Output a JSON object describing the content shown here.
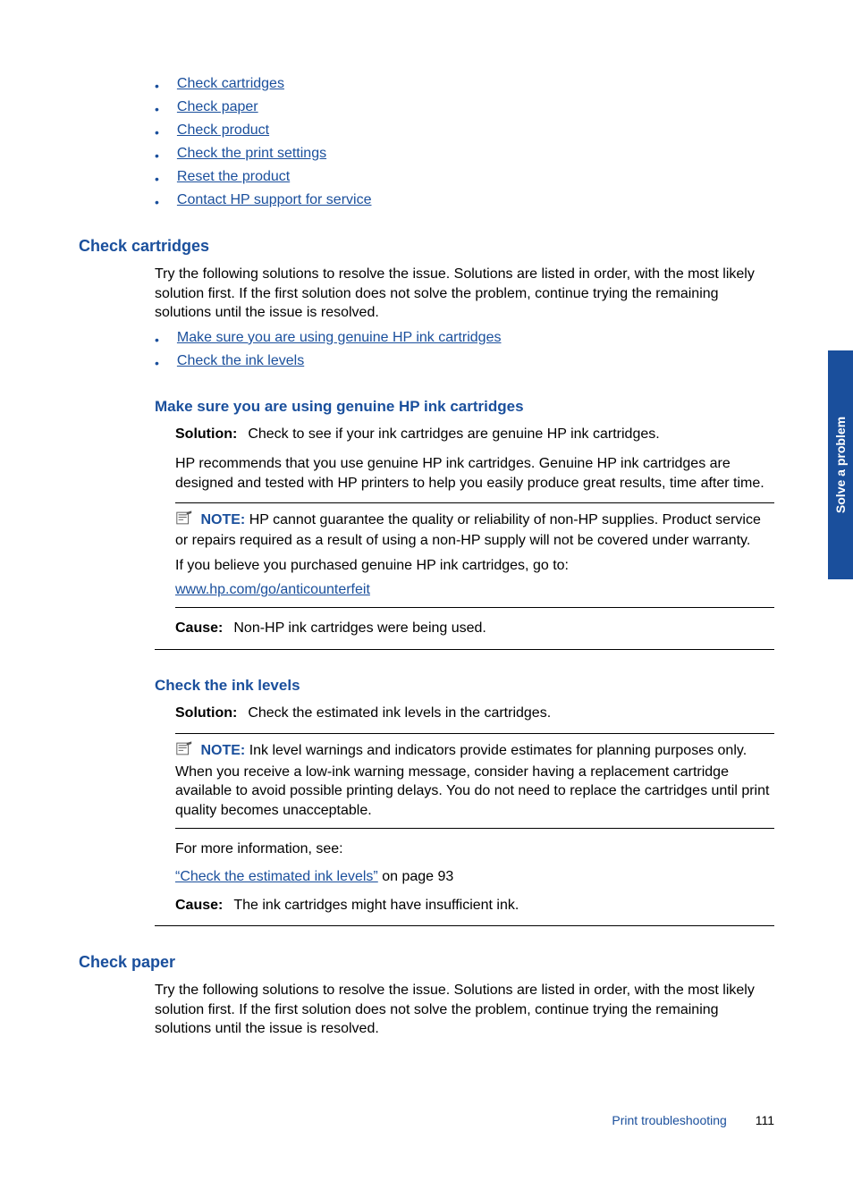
{
  "toc": {
    "items": [
      "Check cartridges",
      "Check paper",
      "Check product",
      "Check the print settings",
      "Reset the product",
      "Contact HP support for service"
    ]
  },
  "section1": {
    "heading": "Check cartridges",
    "intro": "Try the following solutions to resolve the issue. Solutions are listed in order, with the most likely solution first. If the first solution does not solve the problem, continue trying the remaining solutions until the issue is resolved.",
    "sublinks": [
      "Make sure you are using genuine HP ink cartridges",
      "Check the ink levels"
    ],
    "sub1": {
      "heading": "Make sure you are using genuine HP ink cartridges",
      "solution_label": "Solution:",
      "solution_text": "Check to see if your ink cartridges are genuine HP ink cartridges.",
      "para": "HP recommends that you use genuine HP ink cartridges. Genuine HP ink cartridges are designed and tested with HP printers to help you easily produce great results, time after time.",
      "note_label": "NOTE:",
      "note_text": "HP cannot guarantee the quality or reliability of non-HP supplies. Product service or repairs required as a result of using a non-HP supply will not be covered under warranty.",
      "note_para2": "If you believe you purchased genuine HP ink cartridges, go to:",
      "note_link": "www.hp.com/go/anticounterfeit",
      "cause_label": "Cause:",
      "cause_text": "Non-HP ink cartridges were being used."
    },
    "sub2": {
      "heading": "Check the ink levels",
      "solution_label": "Solution:",
      "solution_text": "Check the estimated ink levels in the cartridges.",
      "note_label": "NOTE:",
      "note_text": "Ink level warnings and indicators provide estimates for planning purposes only. When you receive a low-ink warning message, consider having a replacement cartridge available to avoid possible printing delays. You do not need to replace the cartridges until print quality becomes unacceptable.",
      "more_info": "For more information, see:",
      "xref": "“Check the estimated ink levels”",
      "xref_suffix": " on page 93",
      "cause_label": "Cause:",
      "cause_text": "The ink cartridges might have insufficient ink."
    }
  },
  "section2": {
    "heading": "Check paper",
    "intro": "Try the following solutions to resolve the issue. Solutions are listed in order, with the most likely solution first. If the first solution does not solve the problem, continue trying the remaining solutions until the issue is resolved."
  },
  "sidebar": {
    "label": "Solve a problem"
  },
  "footer": {
    "title": "Print troubleshooting",
    "page": "111"
  }
}
